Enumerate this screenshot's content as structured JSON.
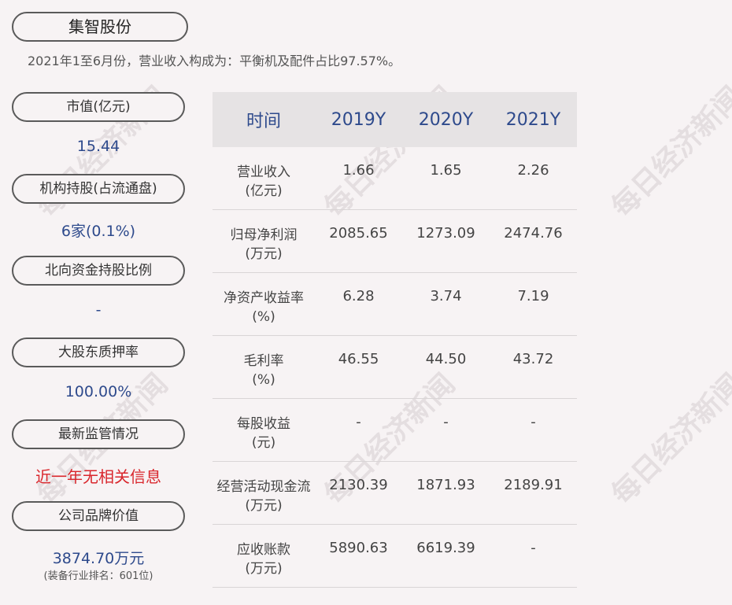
{
  "header": {
    "company": "集智股份",
    "summary": "2021年1至6月份，营业收入构成为：平衡机及配件占比97.57%。"
  },
  "sidebar": {
    "items": [
      {
        "label": "市值(亿元)",
        "value": "15.44"
      },
      {
        "label": "机构持股(占流通盘)",
        "value": "6家(0.1%)"
      },
      {
        "label": "北向资金持股比例",
        "value": "-"
      },
      {
        "label": "大股东质押率",
        "value": "100.00%"
      },
      {
        "label": "最新监管情况",
        "value": "近一年无相关信息"
      },
      {
        "label": "公司品牌价值",
        "value": "3874.70万元",
        "note": "(装备行业排名：601位)"
      }
    ]
  },
  "table": {
    "headers": [
      "时间",
      "2019Y",
      "2020Y",
      "2021Y"
    ],
    "rows": [
      {
        "label": [
          "营业收入",
          "(亿元)"
        ],
        "values": [
          "1.66",
          "1.65",
          "2.26"
        ]
      },
      {
        "label": [
          "归母净利润",
          "(万元)"
        ],
        "values": [
          "2085.65",
          "1273.09",
          "2474.76"
        ]
      },
      {
        "label": [
          "净资产收益率",
          "(%)"
        ],
        "values": [
          "6.28",
          "3.74",
          "7.19"
        ]
      },
      {
        "label": [
          "毛利率",
          "(%)"
        ],
        "values": [
          "46.55",
          "44.50",
          "43.72"
        ]
      },
      {
        "label": [
          "每股收益",
          "(元)"
        ],
        "values": [
          "-",
          "-",
          "-"
        ]
      },
      {
        "label": [
          "经营活动现金流",
          "(万元)"
        ],
        "values": [
          "2130.39",
          "1871.93",
          "2189.91"
        ]
      },
      {
        "label": [
          "应收账款",
          "(万元)"
        ],
        "values": [
          "5890.63",
          "6619.39",
          "-"
        ]
      }
    ]
  },
  "watermark": "每日经济新闻",
  "colors": {
    "accent": "#2e4a8c",
    "alert": "#d9262c",
    "header_bg": "#e6e3e4",
    "page_bg": "#f7f3f4"
  }
}
